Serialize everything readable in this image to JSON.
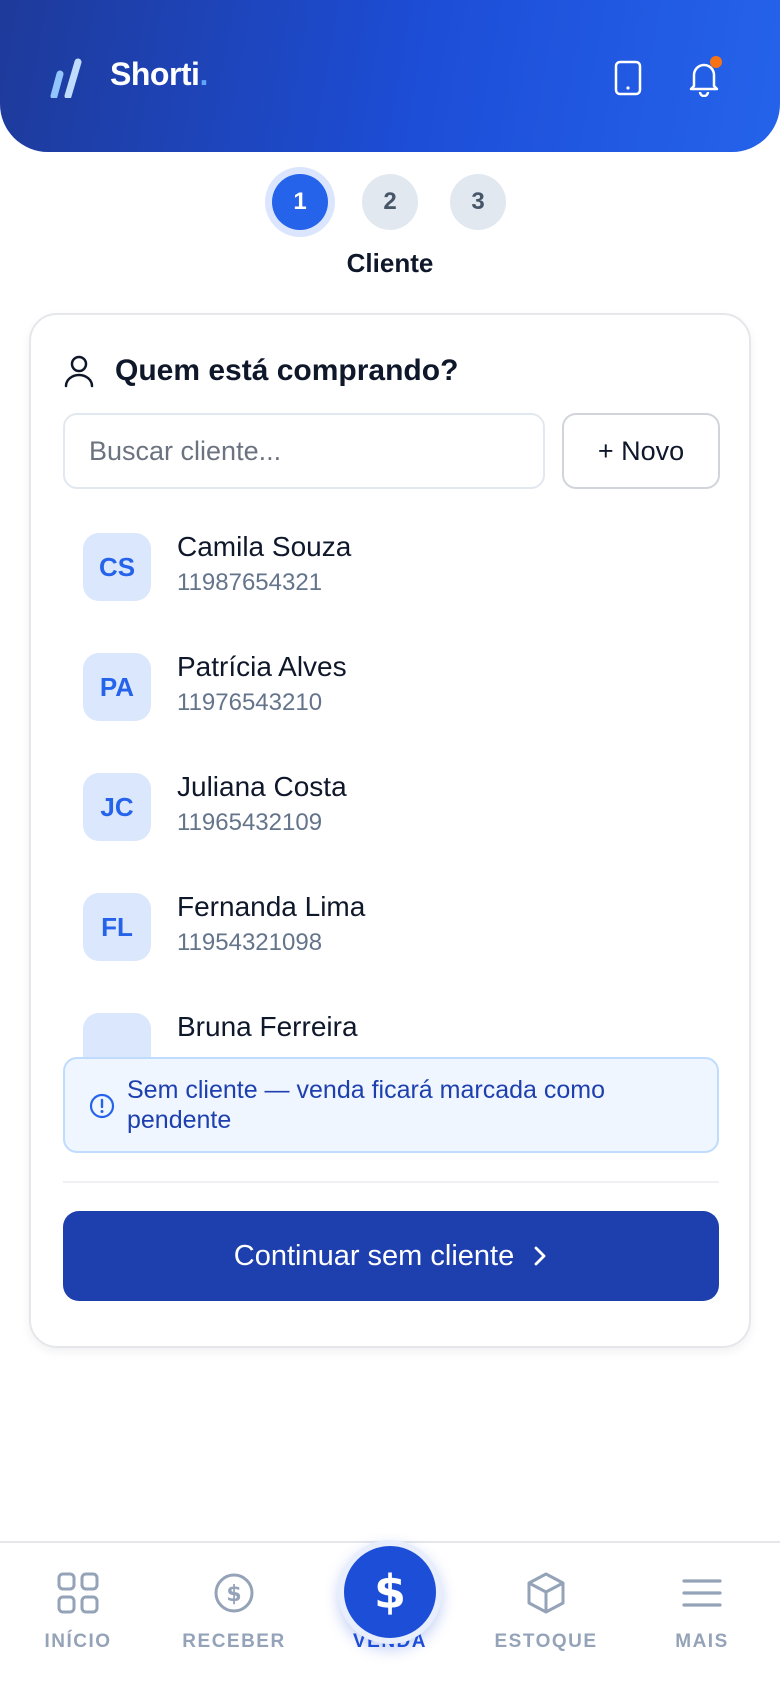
{
  "app": {
    "brand": "Shorti",
    "brand_dot": "."
  },
  "stepper": {
    "steps": [
      "1",
      "2",
      "3"
    ],
    "current_label": "Cliente"
  },
  "card": {
    "title": "Quem está comprando?",
    "search_placeholder": "Buscar cliente...",
    "new_button": "+ Novo",
    "clients": [
      {
        "initials": "CS",
        "name": "Camila Souza",
        "phone": "11987654321"
      },
      {
        "initials": "PA",
        "name": "Patrícia Alves",
        "phone": "11976543210"
      },
      {
        "initials": "JC",
        "name": "Juliana Costa",
        "phone": "11965432109"
      },
      {
        "initials": "FL",
        "name": "Fernanda Lima",
        "phone": "11954321098"
      },
      {
        "initials": "",
        "name": "Bruna Ferreira",
        "phone": ""
      }
    ],
    "notice": "Sem cliente — venda ficará marcada como pendente",
    "cta": "Continuar sem cliente"
  },
  "nav": {
    "items": [
      {
        "label": "INÍCIO",
        "icon": "grid-icon"
      },
      {
        "label": "RECEBER",
        "icon": "dollar-circle-icon"
      },
      {
        "label": "VENDA",
        "icon": "dollar-icon"
      },
      {
        "label": "ESTOQUE",
        "icon": "box-icon"
      },
      {
        "label": "MAIS",
        "icon": "menu-icon"
      }
    ],
    "active": "VENDA"
  },
  "colors": {
    "primary": "#1d4ed8",
    "accent_dot": "#f97316",
    "muted": "#94a3b8"
  }
}
